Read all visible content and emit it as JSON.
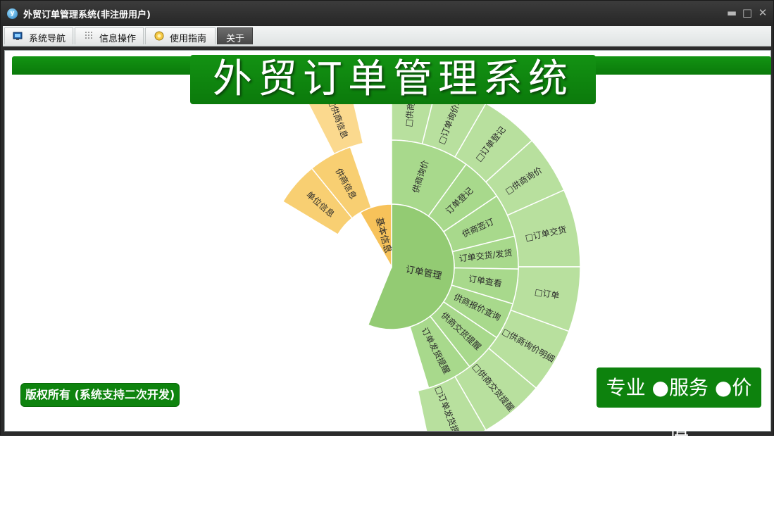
{
  "window": {
    "title": "外贸订单管理系统(非注册用户)",
    "controls": [
      "minimize",
      "restore",
      "close"
    ]
  },
  "menu": {
    "items": [
      {
        "label": "系统导航",
        "icon": "monitor-icon"
      },
      {
        "label": "信息操作",
        "icon": "grid-icon"
      },
      {
        "label": "使用指南",
        "icon": "help-icon"
      },
      {
        "label": "关于",
        "icon": "",
        "active": true
      }
    ]
  },
  "banner": {
    "title": "外贸订单管理系统"
  },
  "copyright": "版权所有 (系统支持二次开发)",
  "slogan": "专业 ●服务 ●价值",
  "colors": {
    "titlebar": "#2b2b2b",
    "brand_green": "#0b7a0b",
    "ring_green_inner": "#93cb73",
    "ring_green": "#a8d98c",
    "ring_green_outer": "#b8e09e",
    "ring_yellow_inner": "#f7c25a",
    "ring_yellow": "#f8cf72",
    "ring_yellow_outer": "#fbd98e"
  },
  "sunburst": {
    "inner": [
      {
        "label": "订单管理",
        "color": "green"
      },
      {
        "label": "基本信息",
        "color": "yellow"
      }
    ],
    "middle": [
      {
        "label": "供商询价",
        "color": "green"
      },
      {
        "label": "订单登记",
        "color": "green"
      },
      {
        "label": "供商签订",
        "color": "green"
      },
      {
        "label": "订单交货/发货",
        "color": "green"
      },
      {
        "label": "订单查看",
        "color": "green"
      },
      {
        "label": "供商报价查询",
        "color": "green"
      },
      {
        "label": "供商交货提醒",
        "color": "green"
      },
      {
        "label": "订单发货提醒",
        "color": "green"
      },
      {
        "label": "单位信息",
        "color": "yellow"
      },
      {
        "label": "供商信息",
        "color": "yellow"
      }
    ],
    "outer": [
      {
        "label": "□供商询",
        "color": "green"
      },
      {
        "label": "□订单询价单",
        "color": "green"
      },
      {
        "label": "□订单登记",
        "color": "green"
      },
      {
        "label": "□供商询价",
        "color": "green"
      },
      {
        "label": "□订单交货",
        "color": "green"
      },
      {
        "label": "□订单",
        "color": "green"
      },
      {
        "label": "□供商询价明细",
        "color": "green"
      },
      {
        "label": "□供商交货提醒",
        "color": "green"
      },
      {
        "label": "□订单发货提醒",
        "color": "green"
      },
      {
        "label": "□供商信息",
        "color": "yellow"
      }
    ]
  }
}
